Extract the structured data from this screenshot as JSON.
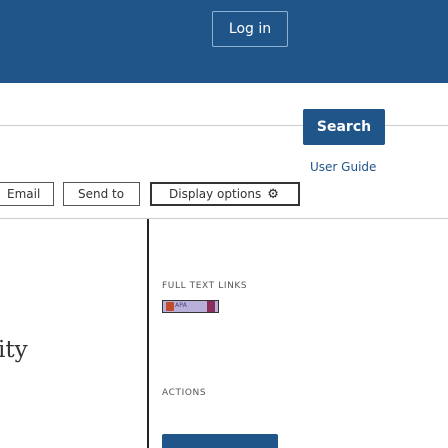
{
  "header": {
    "login_label": "Log in",
    "brand_color": "#20558a"
  },
  "search": {
    "button_label": "Search"
  },
  "links": {
    "user_guide": "User Guide"
  },
  "toolbar": {
    "email_label": "Email",
    "send_to_label": "Send to",
    "display_options_label": "Display options",
    "display_options_icon": "gear-icon"
  },
  "sidebar": {
    "full_text_links_heading": "FULL TEXT LINKS",
    "linkout_text": "APA",
    "actions_heading": "ACTIONS"
  },
  "main": {
    "partial_title": "ity"
  }
}
